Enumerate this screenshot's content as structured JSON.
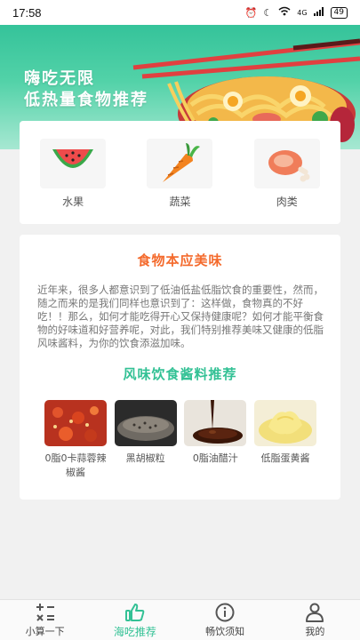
{
  "status": {
    "time": "17:58",
    "battery": "49",
    "signal": "4G"
  },
  "banner": {
    "line1": "嗨吃无限",
    "line2": "低热量食物推荐"
  },
  "categories": [
    {
      "label": "水果",
      "icon": "watermelon-icon"
    },
    {
      "label": "蔬菜",
      "icon": "carrot-icon"
    },
    {
      "label": "肉类",
      "icon": "meat-icon"
    }
  ],
  "article": {
    "title": "食物本应美味",
    "body": "近年来，很多人都意识到了低油低盐低脂饮食的重要性，然而，随之而来的是我们同样也意识到了：这样做，食物真的不好吃！！那么，如何才能吃得开心又保持健康呢？如何才能平衡食物的好味道和好营养呢，对此，我们特别推荐美味又健康的低脂风味酱料，为你的饮食添滋加味。",
    "sauce_title": "风味饮食酱料推荐",
    "sauces": [
      {
        "label": "0脂0卡蒜蓉辣椒酱"
      },
      {
        "label": "黑胡椒粒"
      },
      {
        "label": "0脂油醋汁"
      },
      {
        "label": "低脂蛋黄酱"
      }
    ]
  },
  "nav": {
    "items": [
      {
        "label": "小算一下",
        "icon": "calculator-icon"
      },
      {
        "label": "海吃推荐",
        "icon": "thumbs-up-icon"
      },
      {
        "label": "畅饮须知",
        "icon": "info-icon"
      },
      {
        "label": "我的",
        "icon": "user-icon"
      }
    ],
    "active_index": 1
  },
  "colors": {
    "accent_green": "#33c195",
    "accent_orange": "#f46a2c"
  }
}
